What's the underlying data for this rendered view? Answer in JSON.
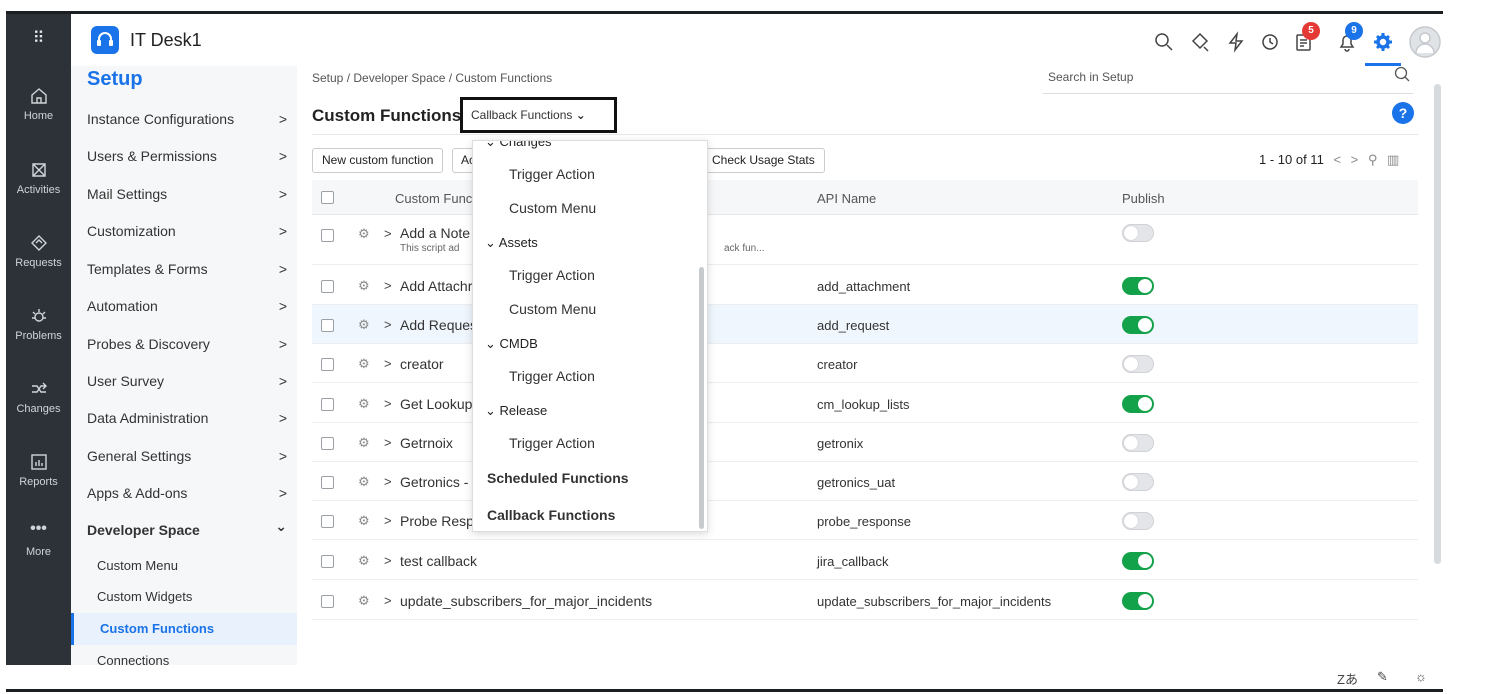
{
  "app": {
    "title": "IT Desk1"
  },
  "rail": {
    "items": [
      {
        "label": "Home",
        "icon": "home-icon"
      },
      {
        "label": "Activities",
        "icon": "activities-icon"
      },
      {
        "label": "Requests",
        "icon": "requests-icon"
      },
      {
        "label": "Problems",
        "icon": "problems-icon"
      },
      {
        "label": "Changes",
        "icon": "changes-icon"
      },
      {
        "label": "Reports",
        "icon": "reports-icon"
      },
      {
        "label": "More",
        "icon": "more-icon"
      }
    ]
  },
  "header": {
    "badges": {
      "tasks": "5",
      "notifications": "9"
    },
    "badge_colors": {
      "tasks": "#e53935",
      "notifications": "#1a73e8"
    }
  },
  "sidebar": {
    "title": "Setup",
    "items": [
      "Instance Configurations",
      "Users & Permissions",
      "Mail Settings",
      "Customization",
      "Templates & Forms",
      "Automation",
      "Probes & Discovery",
      "User Survey",
      "Data Administration",
      "General Settings",
      "Apps & Add-ons",
      "Developer Space"
    ],
    "sub_items": [
      "Custom Menu",
      "Custom Widgets",
      "Custom Functions",
      "Connections"
    ],
    "chevron_right": ">",
    "chevron_down": "⌄"
  },
  "main": {
    "breadcrumb": "Setup / Developer Space / Custom Functions",
    "search_placeholder": "Search in Setup",
    "title": "Custom Functions",
    "dropdown_label": "Callback Functions",
    "buttons": {
      "new": "New custom function",
      "a": "Ac",
      "check": "Check Usage Stats"
    },
    "pager": "1 - 10 of 11",
    "columns": {
      "name": "Custom Function",
      "api": "API Name",
      "publish": "Publish"
    },
    "rows": [
      {
        "name": "Add a Note",
        "desc": "This script ad",
        "desc2": "ack fun...",
        "api": "",
        "on": false
      },
      {
        "name": "Add Attachr",
        "api": "add_attachment",
        "on": true
      },
      {
        "name": "Add Reques",
        "api": "add_request",
        "on": true
      },
      {
        "name": "creator",
        "api": "creator",
        "on": false
      },
      {
        "name": "Get Lookup",
        "api": "cm_lookup_lists",
        "on": true
      },
      {
        "name": "Getrnoix",
        "api": "getronix",
        "on": false
      },
      {
        "name": "Getronics -",
        "api": "getronics_uat",
        "on": false
      },
      {
        "name": "Probe Respo",
        "api": "probe_response",
        "on": false
      },
      {
        "name": "test callback",
        "api": "jira_callback",
        "on": true
      },
      {
        "name": "update_subscribers_for_major_incidents",
        "api": "update_subscribers_for_major_incidents",
        "on": true
      }
    ]
  },
  "menu": {
    "groups": [
      {
        "label": "Changes",
        "options": [
          "Trigger Action",
          "Custom Menu"
        ]
      },
      {
        "label": "Assets",
        "options": [
          "Trigger Action",
          "Custom Menu"
        ]
      },
      {
        "label": "CMDB",
        "options": [
          "Trigger Action"
        ]
      },
      {
        "label": "Release",
        "options": [
          "Trigger Action"
        ]
      }
    ],
    "bold_items": [
      "Scheduled Functions",
      "Callback Functions"
    ]
  },
  "bottombar": {
    "translate": "Zあ",
    "note": "✎",
    "idea": "☼"
  }
}
